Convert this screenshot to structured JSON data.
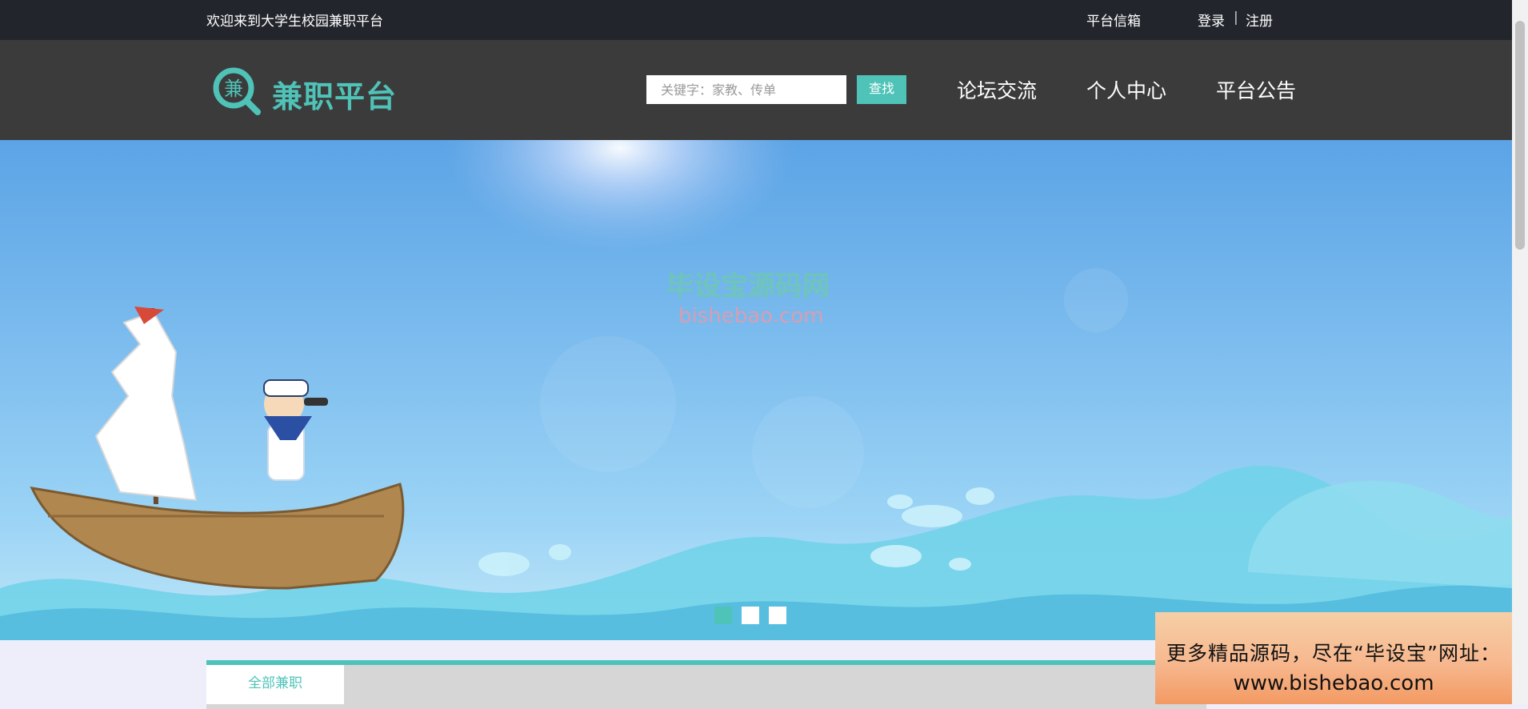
{
  "topbar": {
    "welcome": "欢迎来到大学生校园兼职平台",
    "mailbox": "平台信箱",
    "login": "登录",
    "separator": "|",
    "register": "注册"
  },
  "header": {
    "logo_glyph": "兼",
    "logo_text": "兼职平台",
    "search_placeholder": "关键字：家教、传单",
    "search_button": "查找",
    "nav": [
      "论坛交流",
      "个人中心",
      "平台公告"
    ]
  },
  "banner": {
    "watermark_cn": "毕设宝源码网",
    "watermark_en": "bishebao.com",
    "slide_count": 3,
    "active_slide": 1
  },
  "tabs": {
    "active": "全部兼职"
  },
  "ad": {
    "line1": "更多精品源码，尽在“毕设宝”网址：",
    "line2": "www.bishebao.com"
  },
  "colors": {
    "accent": "#4fc3b8",
    "topbar_bg": "#22252b",
    "header_bg": "#3b3b3b"
  }
}
